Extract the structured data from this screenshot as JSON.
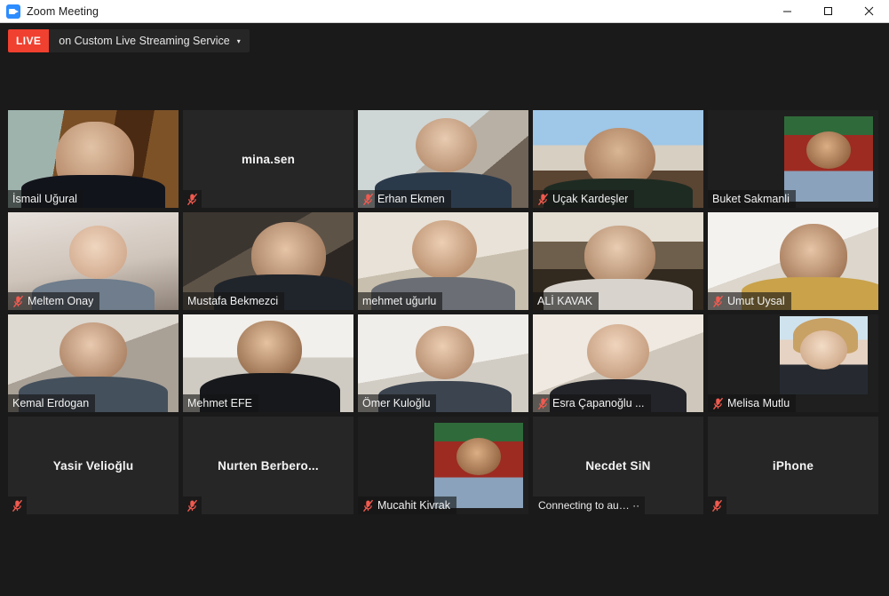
{
  "window": {
    "title": "Zoom Meeting",
    "app_icon": "zoom-camera-icon",
    "controls": {
      "minimize": "minimize-icon",
      "maximize": "maximize-icon",
      "close": "close-icon"
    }
  },
  "live_banner": {
    "badge": "LIVE",
    "label": "on Custom Live Streaming Service",
    "caret": "▾",
    "badge_color": "#f0402f",
    "bar_color": "#262626"
  },
  "theme": {
    "background": "#1a1a1a",
    "tile_background": "#262626",
    "active_speaker_border": "#d8ea3c",
    "mute_icon_color": "#f05a4f",
    "name_text": "#f2f2f2"
  },
  "gallery": {
    "columns": 5,
    "rows": 4,
    "tiles": [
      {
        "name": "İsmail Uğural",
        "type": "video",
        "muted": false,
        "active": false,
        "bg": "bg-a"
      },
      {
        "name": "mina.sen",
        "type": "audio-only",
        "muted": true,
        "active": false,
        "bg": "blank"
      },
      {
        "name": "Erhan Ekmen",
        "type": "video",
        "muted": true,
        "active": false,
        "bg": "bg-c"
      },
      {
        "name": "Uçak Kardeşler",
        "type": "video",
        "muted": true,
        "active": false,
        "bg": "bg-d"
      },
      {
        "name": "Buket Sakmanli",
        "type": "video",
        "muted": false,
        "active": false,
        "bg": "bg-o"
      },
      {
        "name": "Meltem Onay",
        "type": "video",
        "muted": true,
        "active": false,
        "bg": "bg-b"
      },
      {
        "name": "Mustafa Bekmezci",
        "type": "video",
        "muted": false,
        "active": false,
        "bg": "bg-g"
      },
      {
        "name": "mehmet uğurlu",
        "type": "video",
        "muted": false,
        "active": false,
        "bg": "bg-h"
      },
      {
        "name": "ALİ KAVAK",
        "type": "video",
        "muted": false,
        "active": false,
        "bg": "bg-i"
      },
      {
        "name": "Umut Uysal",
        "type": "video",
        "muted": true,
        "active": false,
        "bg": "bg-j"
      },
      {
        "name": "Kemal Erdogan",
        "type": "video",
        "muted": false,
        "active": false,
        "bg": "bg-k"
      },
      {
        "name": "Mehmet EFE",
        "type": "video",
        "muted": false,
        "active": true,
        "bg": "bg-l"
      },
      {
        "name": "Ömer Kuloğlu",
        "type": "video",
        "muted": false,
        "active": false,
        "bg": "bg-m"
      },
      {
        "name": "Esra Çapanoğlu ...",
        "type": "video",
        "muted": true,
        "active": false,
        "bg": "bg-n"
      },
      {
        "name": "Melisa Mutlu",
        "type": "video",
        "muted": true,
        "active": false,
        "bg": "bg-p"
      },
      {
        "name": "Yasir Velioğlu",
        "type": "audio-only",
        "muted": true,
        "active": false,
        "bg": "blank"
      },
      {
        "name": "Nurten  Berbero...",
        "type": "audio-only",
        "muted": true,
        "active": false,
        "bg": "blank"
      },
      {
        "name": "Mucahit Kivrak",
        "type": "video",
        "muted": true,
        "active": false,
        "bg": "bg-o"
      },
      {
        "name": "Necdet SiN",
        "type": "audio-only",
        "muted": false,
        "active": false,
        "bg": "blank",
        "status": "Connecting to au… ··"
      },
      {
        "name": "iPhone",
        "type": "audio-only",
        "muted": true,
        "active": false,
        "bg": "blank"
      }
    ]
  }
}
